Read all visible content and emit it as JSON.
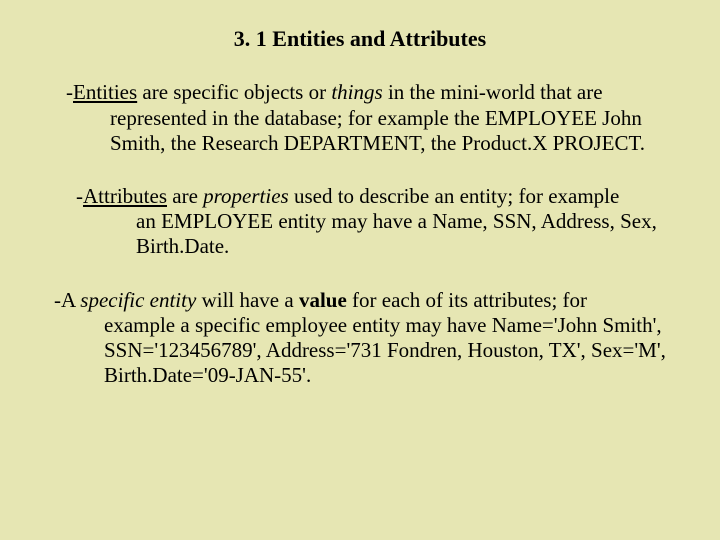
{
  "title": "3. 1 Entities and Attributes",
  "p1": {
    "dash": "- ",
    "lead_ul": "Entities",
    "after_lead": " are specific objects or ",
    "things": "things",
    "after_things": "  in the mini-world that are",
    "cont": "represented in the database; for example the EMPLOYEE John Smith, the Research DEPARTMENT, the Product.X PROJECT."
  },
  "p2": {
    "dash": "-",
    "lead_ul": "Attributes",
    "after_lead": " are ",
    "props": "properties",
    "after_props": "  used to describe an entity; for example",
    "cont": "an EMPLOYEE entity may have a Name, SSN, Address, Sex, Birth.Date."
  },
  "p3": {
    "dash": "-   ",
    "a": "A ",
    "spec": "specific entity",
    "mid1": "  will have a ",
    "val": "value",
    "mid2": " for each of its attributes; for",
    "cont": "example a specific employee entity may have Name='John Smith', SSN='123456789', Address='731 Fondren, Houston, TX', Sex='M', Birth.Date='09-JAN-55'."
  }
}
